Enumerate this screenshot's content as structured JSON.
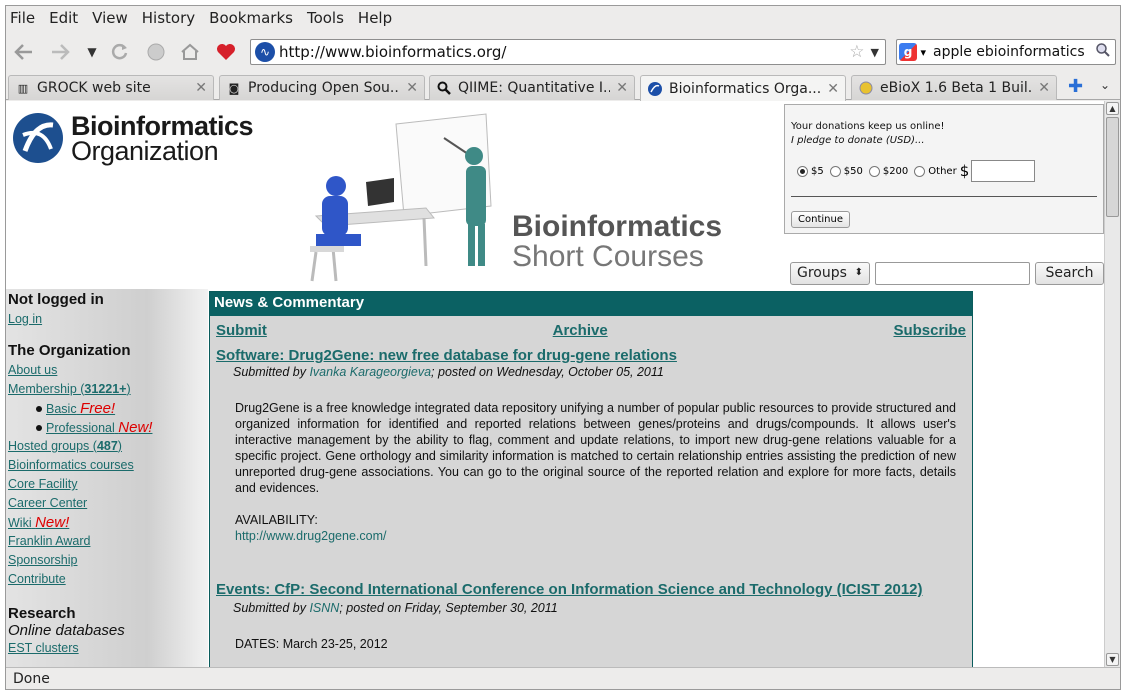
{
  "menu": [
    "File",
    "Edit",
    "View",
    "History",
    "Bookmarks",
    "Tools",
    "Help"
  ],
  "url": "http://www.bioinformatics.org/",
  "search_engine_query": "apple ebioinformatics",
  "tabs": [
    {
      "title": "GROCK web site",
      "icon": "grock-icon"
    },
    {
      "title": "Producing Open Sou...",
      "icon": "page-icon"
    },
    {
      "title": "QIIME: Quantitative I...",
      "icon": "magnifier-icon"
    },
    {
      "title": "Bioinformatics Orga...",
      "icon": "bioinformatics-icon",
      "active": true
    },
    {
      "title": "eBioX 1.6 Beta 1 Buil...",
      "icon": "ebiox-icon"
    }
  ],
  "status": "Done",
  "logo": {
    "line1": "Bioinformatics",
    "line2": "Organization"
  },
  "banner": {
    "line1": "Bioinformatics",
    "line2": "Short Courses"
  },
  "donate": {
    "line1": "Your donations keep us online!",
    "line2": "I pledge to donate (USD)...",
    "options": [
      "$5",
      "$50",
      "$200",
      "Other"
    ],
    "currency": "$",
    "button": "Continue"
  },
  "site_search": {
    "select": "Groups",
    "button": "Search"
  },
  "sidebar": {
    "h1": "Not logged in",
    "login": "Log in",
    "h2": "The Organization",
    "about": "About us",
    "membership": "Membership (",
    "membership_count": "31221+",
    "membership_close": ")",
    "basic": "Basic",
    "free": "Free!",
    "professional": "Professional",
    "new1": "New!",
    "hosted": "Hosted groups (",
    "hosted_count": "487",
    "hosted_close": ")",
    "courses": "Bioinformatics courses",
    "core": "Core Facility",
    "career": "Career Center",
    "wiki": "Wiki",
    "new2": "New!",
    "franklin": "Franklin Award",
    "sponsorship": "Sponsorship",
    "contribute": "Contribute",
    "h3": "Research",
    "online": "Online databases",
    "est": "EST clusters"
  },
  "news": {
    "header": "News & Commentary",
    "submit": "Submit",
    "archive": "Archive",
    "subscribe": "Subscribe",
    "item1_title": "Software: Drug2Gene: new free database for drug-gene relations",
    "item1_sub_pre": "Submitted by ",
    "item1_author": "Ivanka Karageorgieva",
    "item1_sub_post": "; posted on Wednesday, October 05, 2011",
    "item1_body": "Drug2Gene is a free knowledge integrated data repository unifying a number of popular public resources to provide structured and organized information for identified and reported relations between genes/proteins and drugs/compounds. It allows user's interactive management by the ability to flag, comment and update relations, to import new drug-gene relations valuable for a specific project. Gene orthology and similarity information is matched to certain relationship entries assisting the prediction of new unreported drug-gene associations. You can go to the original source of the reported relation and explore for more facts, details and evidences.",
    "item1_avail": "AVAILABILITY:",
    "item1_link": "http://www.drug2gene.com/",
    "item2_title": "Events: CfP: Second International Conference on Information Science and Technology (ICIST 2012)",
    "item2_sub_pre": "Submitted by ",
    "item2_author": "ISNN",
    "item2_sub_post": "; posted on Friday, September 30, 2011",
    "item2_dates": "DATES: March 23-25, 2012"
  }
}
